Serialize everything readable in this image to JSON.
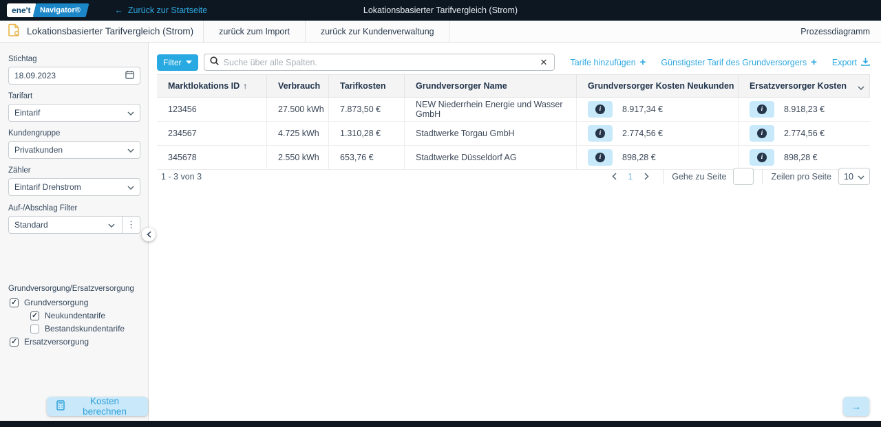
{
  "topbar": {
    "logo_left": "ene't",
    "logo_right": "Navigator®",
    "back_link": "Zurück zur Startseite",
    "title": "Lokationsbasierter Tarifvergleich (Strom)"
  },
  "header": {
    "title": "Lokationsbasierter Tarifvergleich (Strom)",
    "tabs": [
      {
        "label": "zurück zum Import"
      },
      {
        "label": "zurück zur Kundenverwaltung"
      }
    ],
    "right_link": "Prozessdiagramm"
  },
  "sidebar": {
    "fields": [
      {
        "label": "Stichtag",
        "value": "18.09.2023"
      },
      {
        "label": "Tarifart",
        "value": "Eintarif"
      },
      {
        "label": "Kundengruppe",
        "value": "Privatkunden"
      },
      {
        "label": "Zähler",
        "value": "Eintarif Drehstrom"
      },
      {
        "label": "Auf-/Abschlag Filter",
        "value": "Standard"
      }
    ],
    "checkbox_group_label": "Grundversorgung/Ersatzversorgung",
    "checkboxes": [
      {
        "label": "Grundversorgung",
        "checked": true
      },
      {
        "label": "Neukundentarife",
        "checked": true
      },
      {
        "label": "Bestandskundentarife",
        "checked": false
      },
      {
        "label": "Ersatzversorgung",
        "checked": true
      }
    ],
    "calc_button": "Kosten berechnen"
  },
  "toolbar": {
    "filter_label": "Filter",
    "search_placeholder": "Suche über alle Spalten.",
    "clear_label": "✕",
    "add_tariffs_label": "Tarife hinzufügen",
    "cheapest_tariff_label": "Günstigster Tarif des Grundversorgers",
    "export_label": "Export"
  },
  "table": {
    "columns": [
      "Marktlokations ID",
      "Verbrauch",
      "Tarifkosten",
      "Grundversorger Name",
      "Grundversorger Kosten Neukunden",
      "Ersatzversorger Kosten"
    ],
    "sort_icon": "↑",
    "rows": [
      {
        "id": "123456",
        "verbrauch": "27.500 kWh",
        "tarifkosten": "7.873,50 €",
        "name": "NEW Niederrhein Energie und Wasser GmbH",
        "gv_kosten": "8.917,34 €",
        "ev_kosten": "8.918,23 €"
      },
      {
        "id": "234567",
        "verbrauch": "4.725 kWh",
        "tarifkosten": "1.310,28 €",
        "name": "Stadtwerke Torgau GmbH",
        "gv_kosten": "2.774,56 €",
        "ev_kosten": "2.774,56 €"
      },
      {
        "id": "345678",
        "verbrauch": "2.550 kWh",
        "tarifkosten": "653,76 €",
        "name": "Stadtwerke Düsseldorf AG",
        "gv_kosten": "898,28 €",
        "ev_kosten": "898,28 €"
      }
    ]
  },
  "pagination": {
    "range": "1 - 3 von 3",
    "page": "1",
    "goto_label": "Gehe zu Seite",
    "goto_value": "",
    "rows_label": "Zeilen pro Seite",
    "rows_value": "10"
  },
  "colors": {
    "accent_blue": "#29a9e1",
    "topbar_bg": "#0d1722",
    "light_blue_chip": "#c7e9fa"
  }
}
